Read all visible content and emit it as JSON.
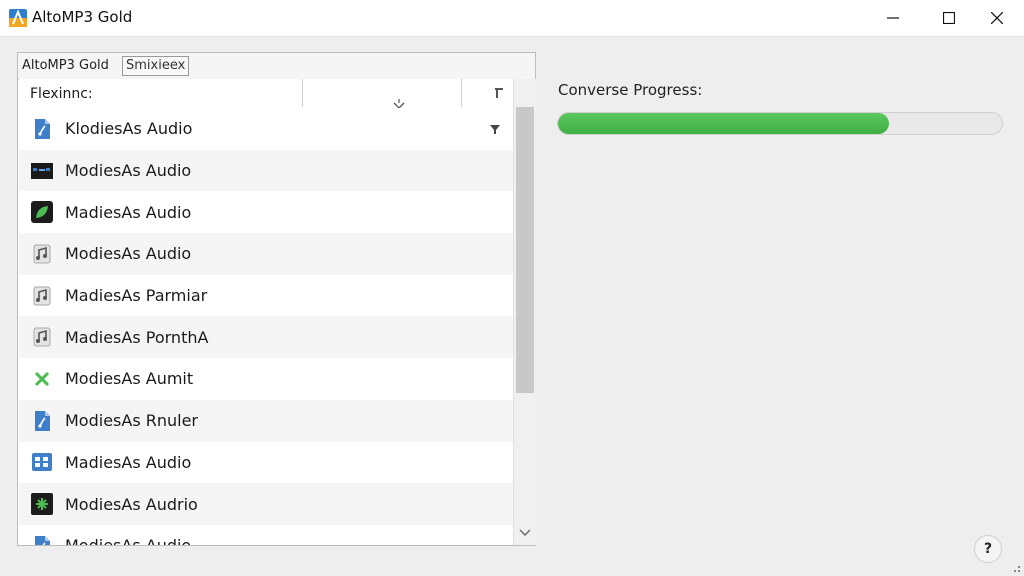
{
  "window": {
    "title": "AltoMP3 Gold"
  },
  "tabs": {
    "label": "AltoMP3 Gold",
    "box_label": "Smixieex"
  },
  "list": {
    "column_name": "Flexinnc:",
    "items": [
      {
        "label": "KlodiesAs Audio",
        "icon": "file-audio-icon"
      },
      {
        "label": "ModiesAs Audio",
        "icon": "video-thumbnail-icon"
      },
      {
        "label": "MadiesAs Audio",
        "icon": "green-leaf-icon"
      },
      {
        "label": "ModiesAs Audio",
        "icon": "music-note-icon"
      },
      {
        "label": "MadiesAs Parmiar",
        "icon": "music-note-icon"
      },
      {
        "label": "MadiesAs PornthA",
        "icon": "music-note-icon"
      },
      {
        "label": "ModiesAs Aumit",
        "icon": "green-x-icon"
      },
      {
        "label": "ModiesAs Rnuler",
        "icon": "file-audio-icon"
      },
      {
        "label": "MadiesAs Audio",
        "icon": "media-grid-icon"
      },
      {
        "label": "ModiesAs Audrio",
        "icon": "green-sparkle-icon"
      },
      {
        "label": "ModiesAs Audio",
        "icon": "file-audio-icon"
      }
    ]
  },
  "progress": {
    "label": "Converse Progress:",
    "value_percent": 74.5
  },
  "help": {
    "label": "?"
  },
  "colors": {
    "progress_fill": "#4cbb50",
    "accent_blue": "#3a78c2"
  }
}
